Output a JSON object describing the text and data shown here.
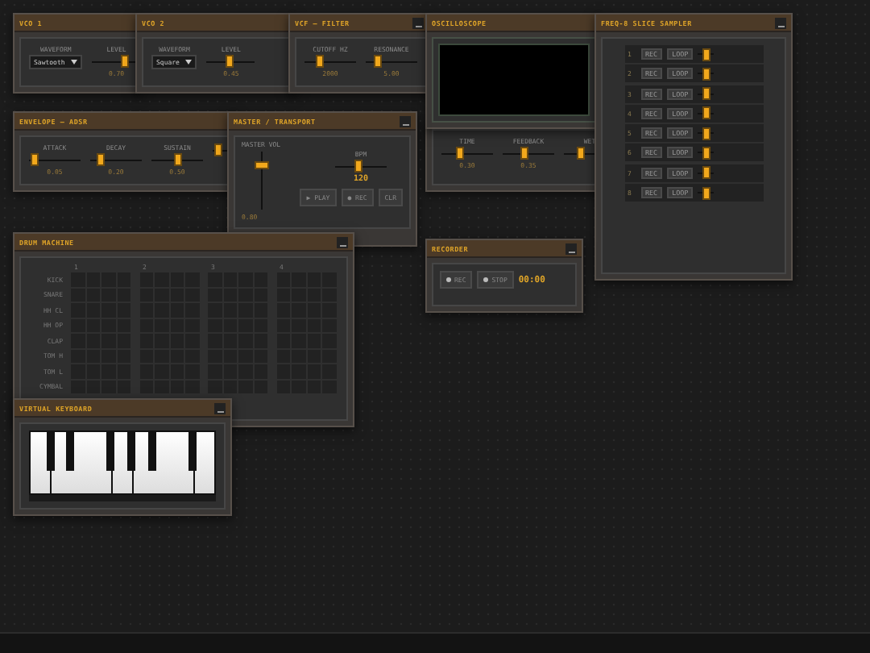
{
  "windows": [
    {
      "kind": "vco",
      "title": "VCO 1",
      "waveform_label": "WAVEFORM",
      "waveform": "Sawtooth",
      "sliders": [
        {
          "label": "LEVEL",
          "level": 0.7,
          "reading": "0.70"
        }
      ]
    },
    {
      "kind": "vco",
      "title": "VCO 2",
      "waveform_label": "WAVEFORM",
      "waveform": "Square",
      "sliders": [
        {
          "label": "LEVEL",
          "level": 0.45,
          "reading": "0.45"
        }
      ]
    },
    {
      "kind": "panel",
      "title": "VCF — FILTER",
      "minimize_button": true,
      "sliders": [
        {
          "label": "CUTOFF HZ",
          "level": 0.25,
          "reading": "2000"
        },
        {
          "label": "RESONANCE",
          "level": 0.2,
          "reading": "5.00"
        }
      ]
    },
    {
      "kind": "panel",
      "sliders": [
        {
          "label": "TIME",
          "level": 0.35,
          "reading": "0.30"
        },
        {
          "label": "FEEDBACK",
          "level": 0.4,
          "reading": "0.35"
        },
        {
          "label": "WET",
          "level": 0.3
        }
      ]
    },
    {
      "kind": "scope",
      "title": "OSCILLOSCOPE"
    },
    {
      "kind": "sampler",
      "title": "FREQ-8 SLICE SAMPLER",
      "minimize_button": true,
      "rows": [
        {
          "number": "1",
          "rec": "REC",
          "loop": "LOOP",
          "level": 0.55
        },
        {
          "number": "2",
          "rec": "REC",
          "loop": "LOOP",
          "level": 0.55
        },
        {
          "number": "3",
          "rec": "REC",
          "loop": "LOOP",
          "level": 0.55
        },
        {
          "number": "4",
          "rec": "REC",
          "loop": "LOOP",
          "level": 0.55
        },
        {
          "number": "5",
          "rec": "REC",
          "loop": "LOOP",
          "level": 0.55
        },
        {
          "number": "6",
          "rec": "REC",
          "loop": "LOOP",
          "level": 0.55
        },
        {
          "number": "7",
          "rec": "REC",
          "loop": "LOOP",
          "level": 0.55
        },
        {
          "number": "8",
          "rec": "REC",
          "loop": "LOOP",
          "level": 0.55
        }
      ]
    },
    {
      "kind": "panel",
      "title": "ENVELOPE — ADSR",
      "sliders": [
        {
          "label": "ATTACK",
          "level": 0.05,
          "reading": "0.05"
        },
        {
          "label": "DECAY",
          "level": 0.15,
          "reading": "0.20"
        },
        {
          "label": "SUSTAIN",
          "level": 0.5,
          "reading": "0.50"
        },
        {
          "level": 0.1
        }
      ]
    },
    {
      "kind": "master",
      "title": "MASTER / TRANSPORT",
      "minimize_button": true,
      "volume": {
        "label": "MASTER VOL",
        "level": 0.8,
        "reading": "0.80"
      },
      "bpm": {
        "label": "BPM",
        "level": 0.45,
        "reading": "120"
      },
      "buttons": [
        "▶ PLAY",
        "● REC",
        "CLR"
      ]
    },
    {
      "kind": "drum",
      "title": "DRUM MACHINE",
      "minimize_button": true,
      "beats": [
        "1",
        "2",
        "3",
        "4"
      ],
      "tracks": [
        {
          "name": "KICK",
          "steps": [
            false,
            false,
            false,
            false,
            false,
            false,
            false,
            false,
            false,
            false,
            false,
            false,
            false,
            false,
            false,
            false
          ]
        },
        {
          "name": "SNARE",
          "steps": [
            false,
            false,
            false,
            false,
            false,
            false,
            false,
            false,
            false,
            false,
            false,
            false,
            false,
            false,
            false,
            false
          ]
        },
        {
          "name": "HH CL",
          "steps": [
            false,
            false,
            false,
            false,
            false,
            false,
            false,
            false,
            false,
            false,
            false,
            false,
            false,
            false,
            false,
            false
          ]
        },
        {
          "name": "HH OP",
          "steps": [
            false,
            false,
            false,
            false,
            false,
            false,
            false,
            false,
            false,
            false,
            false,
            false,
            false,
            false,
            false,
            false
          ]
        },
        {
          "name": "CLAP",
          "steps": [
            false,
            false,
            false,
            false,
            false,
            false,
            false,
            false,
            false,
            false,
            false,
            false,
            false,
            false,
            false,
            false
          ]
        },
        {
          "name": "TOM H",
          "steps": [
            false,
            false,
            false,
            false,
            false,
            false,
            false,
            false,
            false,
            false,
            false,
            false,
            false,
            false,
            false,
            false
          ]
        },
        {
          "name": "TOM L",
          "steps": [
            false,
            false,
            false,
            false,
            false,
            false,
            false,
            false,
            false,
            false,
            false,
            false,
            false,
            false,
            false,
            false
          ]
        },
        {
          "name": "CYMBAL",
          "steps": [
            false,
            false,
            false,
            false,
            false,
            false,
            false,
            false,
            false,
            false,
            false,
            false,
            false,
            false,
            false,
            false
          ]
        }
      ]
    },
    {
      "kind": "keyboard",
      "title": "VIRTUAL KEYBOARD",
      "minimize_button": true
    },
    {
      "kind": "recorder",
      "title": "RECORDER",
      "minimize_button": true,
      "buttons": [
        "REC",
        "STOP"
      ],
      "time": "00:00"
    }
  ]
}
